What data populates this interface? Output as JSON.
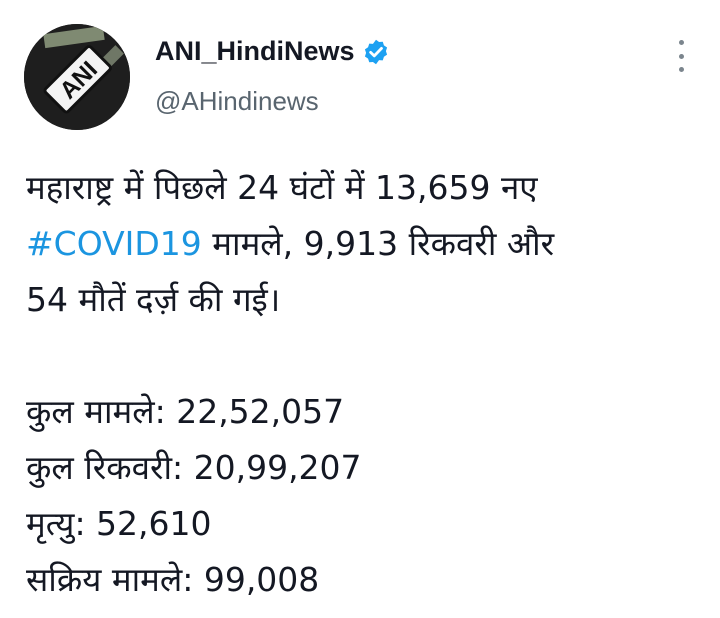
{
  "account": {
    "display_name": "ANI_HindiNews",
    "handle": "@AHindinews",
    "avatar_text": "ANI",
    "verified": true
  },
  "colors": {
    "hashtag": "#1b95e0",
    "verified_badge": "#1da1f2",
    "text": "#141823",
    "secondary": "#59656f"
  },
  "icons": {
    "verified": "verified-badge-icon",
    "menu": "more-vertical-icon"
  },
  "tweet": {
    "line1": "महाराष्ट्र में पिछले 24 घंटों में 13,659 नए",
    "hashtag": "#COVID19",
    "line2_rest": " मामले, 9,913 रिकवरी और",
    "line3": "54 मौतें दर्ज़ की गई।",
    "stats": [
      "कुल मामले: 22,52,057",
      "कुल रिकवरी: 20,99,207",
      "मृत्यु: 52,610",
      "सक्रिय मामले: 99,008"
    ]
  }
}
